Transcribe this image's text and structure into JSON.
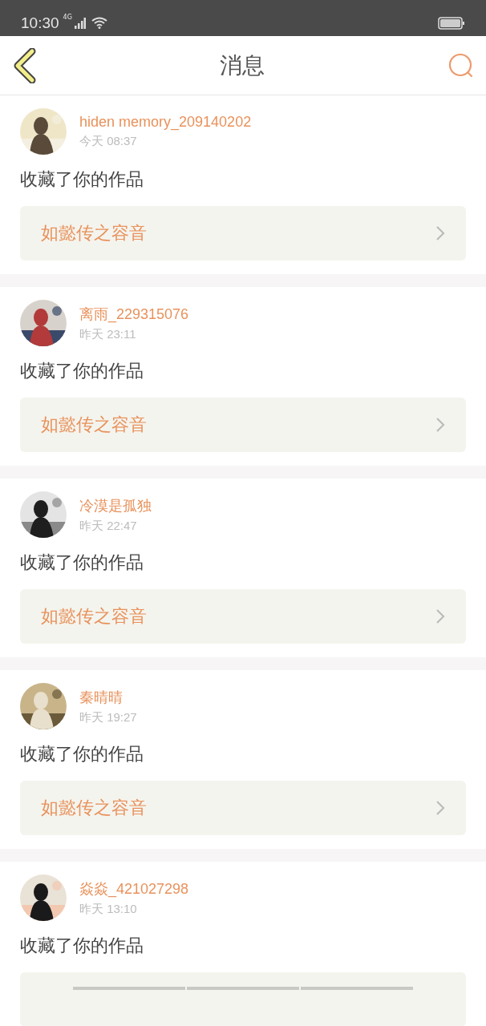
{
  "status_bar": {
    "time": "10:30",
    "network": "4G"
  },
  "header": {
    "title": "消息"
  },
  "messages": [
    {
      "user": "hiden memory_209140202",
      "time": "今天 08:37",
      "action": "收藏了你的作品",
      "link": "如懿传之容音"
    },
    {
      "user": "离雨_229315076",
      "time": "昨天 23:11",
      "action": "收藏了你的作品",
      "link": "如懿传之容音"
    },
    {
      "user": "冷漠是孤独",
      "time": "昨天 22:47",
      "action": "收藏了你的作品",
      "link": "如懿传之容音"
    },
    {
      "user": "秦晴晴",
      "time": "昨天 19:27",
      "action": "收藏了你的作品",
      "link": "如懿传之容音"
    },
    {
      "user": "焱焱_421027298",
      "time": "昨天 13:10",
      "action": "收藏了你的作品"
    }
  ]
}
